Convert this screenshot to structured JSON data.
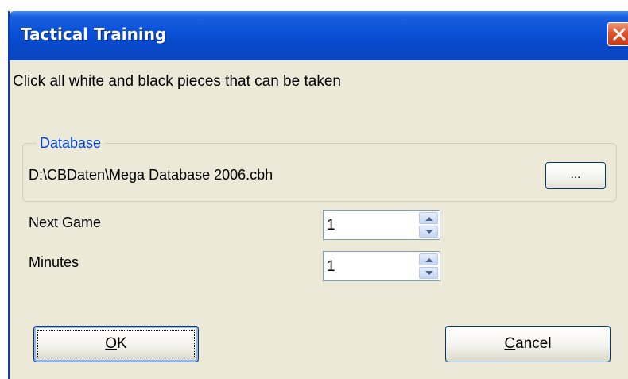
{
  "window": {
    "title": "Tactical Training"
  },
  "instruction": "Click all white and black pieces that can be taken",
  "database": {
    "group_label": "Database",
    "path": "D:\\CBDaten\\Mega Database 2006.cbh",
    "browse_label": "..."
  },
  "fields": {
    "next_game": {
      "label": "Next Game",
      "value": "1"
    },
    "minutes": {
      "label": "Minutes",
      "value": "1"
    }
  },
  "buttons": {
    "ok": {
      "mnemonic": "O",
      "rest": "K"
    },
    "cancel": {
      "mnemonic": "C",
      "rest": "ancel"
    }
  },
  "colors": {
    "titlebar": "#0a52d9",
    "dialog_bg": "#ece9d8",
    "group_label": "#0046d5",
    "close_button": "#e0532d"
  },
  "icons": {
    "close": "close-icon",
    "spin_up": "arrow-up-icon",
    "spin_down": "arrow-down-icon"
  }
}
